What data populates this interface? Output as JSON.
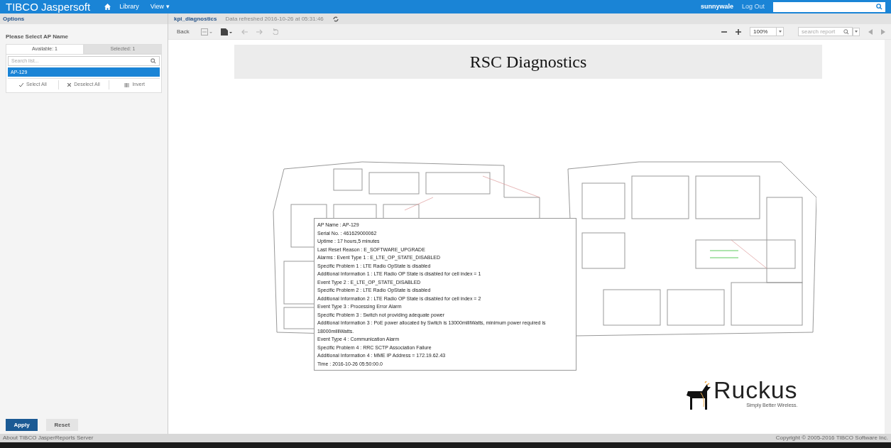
{
  "topbar": {
    "brand": "TIBCO Jaspersoft",
    "nav": [
      {
        "label": "Library"
      },
      {
        "label": "View ▾"
      }
    ],
    "user": "sunnywale",
    "logout": "Log Out"
  },
  "options_panel": {
    "title": "Options",
    "section": "Please Select AP Name",
    "tabs": [
      {
        "label": "Available: 1",
        "selected": true
      },
      {
        "label": "Selected: 1",
        "selected": false
      }
    ],
    "search_placeholder": "Search list...",
    "items": [
      {
        "label": "AP-129",
        "selected": true
      }
    ],
    "actions": [
      "Select All",
      "Deselect All",
      "Invert"
    ],
    "apply": "Apply",
    "reset": "Reset"
  },
  "report": {
    "name": "kpi_diagnostics",
    "refreshed": "Data refreshed 2016-10-26 at 05:31:46",
    "back": "Back",
    "zoom": "100%",
    "search_placeholder": "search report",
    "title": "RSC Diagnostics",
    "tooltip": [
      "AP Name : AP-129",
      "Serial No. : 461629000062",
      "Uptime : 17 hours,5 minutes",
      "Last Reset Reason : E_SOFTWARE_UPGRADE",
      "Alarms : Event Type 1 : E_LTE_OP_STATE_DISABLED",
      "Specific Problem 1 : LTE Radio OpState is disabled",
      "Additional Information 1 : LTE Radio OP State is disabled for cell index = 1",
      "Event Type 2 : E_LTE_OP_STATE_DISABLED",
      "Specific Problem 2 : LTE Radio OpState is disabled",
      "Additional Information 2 : LTE Radio OP State is disabled for cell index = 2",
      "Event Type 3 : Processing Error Alarm",
      "Specific Problem 3 : Switch not providing adequate power",
      "Additional Information 3 : PoE power allocated by Switch is 13000milliWatts, minimum power required is 18000milliWatts.",
      "Event Type 4 : Communication Alarm",
      "Specific Problem 4 : RRC SCTP Association Failure",
      "Additional Information 4 : MME IP Address = 172.19.62.43",
      "Time : 2016-10-26 05:50:00.0"
    ],
    "logo": {
      "name": "Ruckus",
      "tagline": "Simply Better Wireless."
    }
  },
  "footer": {
    "left": "About TIBCO JasperReports Server",
    "right": "Copyright © 2005-2016 TIBCO Software Inc."
  }
}
